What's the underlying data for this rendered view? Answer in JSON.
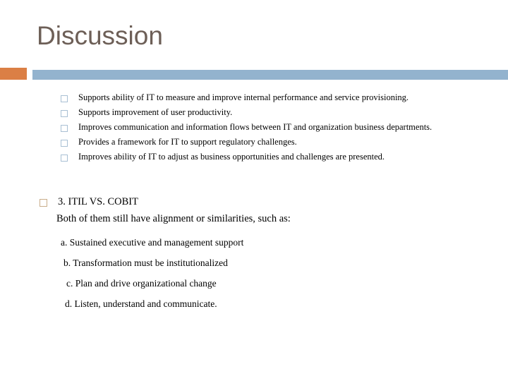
{
  "slide": {
    "title": "Discussion",
    "theme": {
      "title_color": "#6d5f57",
      "accent_orange": "#db7f45",
      "accent_blue": "#93b3ce",
      "level2_marker_color": "#a9c0d4",
      "level1_marker_color": "#c9ad8a",
      "body_text_color": "#000000",
      "background": "#ffffff"
    },
    "level2_bullets": [
      {
        "marker": "hollow-square-bullet",
        "text": "Supports ability of IT to measure and improve internal performance and service provisioning."
      },
      {
        "marker": "hollow-square-bullet",
        "text": "Supports improvement of user productivity."
      },
      {
        "marker": "hollow-square-bullet",
        "text": "Improves communication and information flows between IT and organization business departments."
      },
      {
        "marker": "hollow-square-bullet",
        "text": "Provides a framework for IT to support regulatory challenges."
      },
      {
        "marker": "hollow-square-bullet",
        "text": "Improves ability of IT to adjust as business opportunities and challenges are presented."
      }
    ],
    "section": {
      "marker": "hollow-square-bullet",
      "heading": "3. ITIL VS. COBIT",
      "intro": "Both of them still have alignment or similarities, such as:"
    },
    "sub_items": [
      {
        "text": "a. Sustained executive and management support"
      },
      {
        "text": "b. Transformation must be institutionalized"
      },
      {
        "text": "c. Plan and drive organizational change"
      },
      {
        "text": "d. Listen, understand and communicate."
      }
    ]
  }
}
